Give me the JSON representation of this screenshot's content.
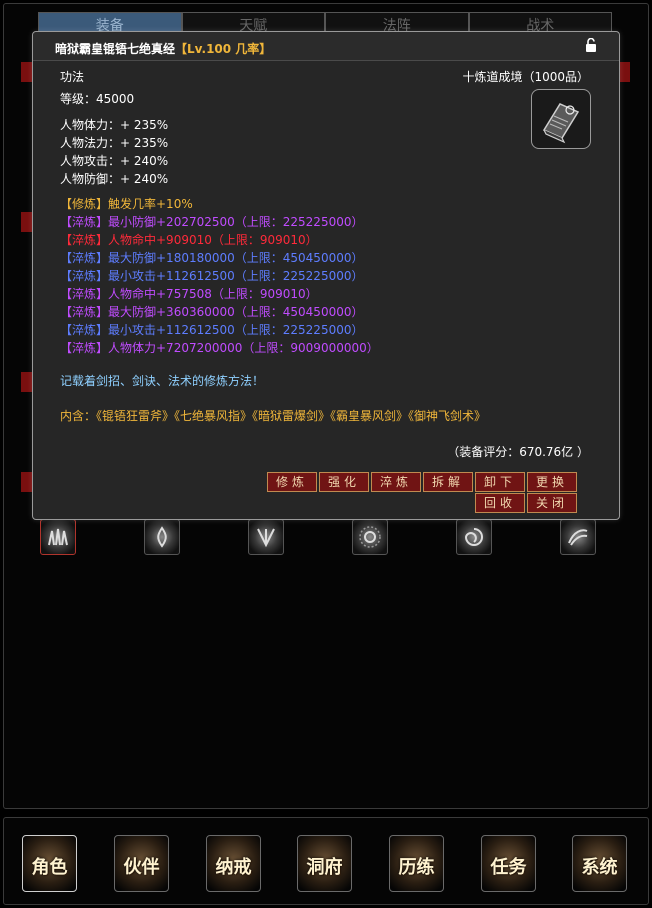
{
  "background": {
    "tabs": [
      "装备",
      "天赋",
      "法阵",
      "战术"
    ]
  },
  "item": {
    "name": "暗狱霸皇锟铻七绝真经",
    "level_tag": "【Lv.100 几率】",
    "type": "功法",
    "realm": "十炼道成境（1000品）",
    "grade": "等级：45000",
    "base_stats": [
      "人物体力：+ 235%",
      "人物法力：+ 235%",
      "人物攻击：+ 240%",
      "人物防御：+ 240%"
    ],
    "refine_lines": [
      {
        "text": "【修炼】触发几率+10%",
        "color": "#f0b63a"
      },
      {
        "text": "【淬炼】最小防御+202702500（上限：225225000）",
        "color": "#c04cff"
      },
      {
        "text": "【淬炼】人物命中+909010（上限：909010）",
        "color": "#ff2a3a"
      },
      {
        "text": "【淬炼】最大防御+180180000（上限：450450000）",
        "color": "#5e7dff"
      },
      {
        "text": "【淬炼】最小攻击+112612500（上限：225225000）",
        "color": "#5e7dff"
      },
      {
        "text": "【淬炼】人物命中+757508（上限：909010）",
        "color": "#c04cff"
      },
      {
        "text": "【淬炼】最大防御+360360000（上限：450450000）",
        "color": "#c04cff"
      },
      {
        "text": "【淬炼】最小攻击+112612500（上限：225225000）",
        "color": "#5e7dff"
      },
      {
        "text": "【淬炼】人物体力+7207200000（上限：9009000000）",
        "color": "#c04cff"
      }
    ],
    "description": "记载着剑招、剑诀、法术的修炼方法！",
    "contains": "内含：《锟铻狂雷斧》《七绝暴风指》《暗狱雷爆剑》《霸皇暴风剑》《御神飞剑术》",
    "score": "（装备评分：670.76亿 ）"
  },
  "buttons": {
    "row1": [
      "修炼",
      "强化",
      "淬炼",
      "拆解",
      "卸下",
      "更换"
    ],
    "row2": [
      "回收",
      "关闭"
    ]
  },
  "icons": {
    "lock": "unlock-icon",
    "book": "manual-book-icon"
  },
  "bottom_nav": [
    "角色",
    "伙伴",
    "纳戒",
    "洞府",
    "历练",
    "任务",
    "系统"
  ]
}
